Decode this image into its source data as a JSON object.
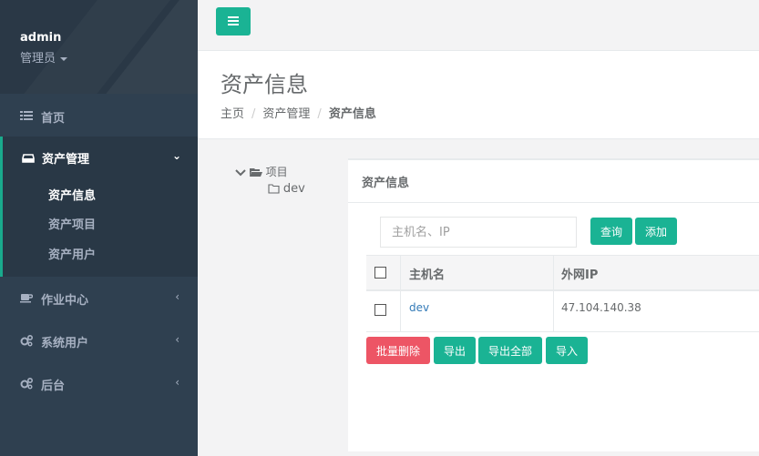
{
  "sidebar": {
    "profile": {
      "name": "admin",
      "role": "管理员"
    },
    "items": [
      {
        "label": "首页",
        "icon": "list-icon"
      },
      {
        "label": "资产管理",
        "icon": "inbox-icon",
        "expanded": true,
        "children": [
          {
            "label": "资产信息",
            "active": true
          },
          {
            "label": "资产项目"
          },
          {
            "label": "资产用户"
          }
        ]
      },
      {
        "label": "作业中心",
        "icon": "coffee-icon"
      },
      {
        "label": "系统用户",
        "icon": "cogs-icon"
      },
      {
        "label": "后台",
        "icon": "cogs-icon"
      }
    ]
  },
  "topbar": {
    "menu_icon": "hamburger-icon"
  },
  "heading": {
    "title": "资产信息",
    "breadcrumb": [
      "主页",
      "资产管理",
      "资产信息"
    ]
  },
  "tree": {
    "root": "项目",
    "children": [
      "dev"
    ]
  },
  "panel": {
    "title": "资产信息",
    "search": {
      "placeholder": "主机名、IP",
      "value": ""
    },
    "buttons": {
      "query": "查询",
      "add": "添加"
    },
    "table": {
      "columns": [
        "主机名",
        "外网IP"
      ],
      "rows": [
        {
          "hostname": "dev",
          "public_ip": "47.104.140.38"
        }
      ]
    },
    "actions": {
      "batch_delete": "批量删除",
      "export": "导出",
      "export_all": "导出全部",
      "import": "导入"
    }
  },
  "colors": {
    "sidebar_bg": "#2f4050",
    "accent": "#1ab394",
    "danger": "#ed5565",
    "link": "#337ab7"
  }
}
